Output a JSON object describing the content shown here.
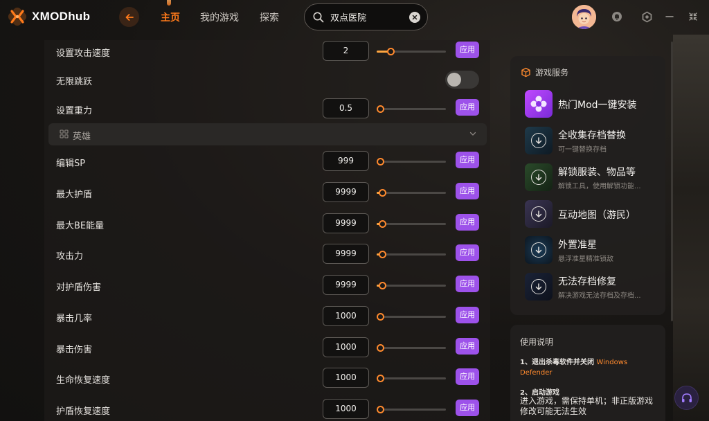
{
  "header": {
    "logo_text": "XMODhub",
    "nav": {
      "home": "主页",
      "my_games": "我的游戏",
      "explore": "探索"
    },
    "search_value": "双点医院",
    "icons": [
      "back-arrow-icon",
      "search-icon",
      "clear-icon",
      "bell-icon",
      "settings-hex-icon",
      "minimize-icon",
      "collapse-icon"
    ]
  },
  "settings": {
    "apply_label": "应用",
    "rows_top": [
      {
        "label": "设置攻击速度",
        "value": "2",
        "level": 0.2
      },
      {
        "label": "无限跳跃",
        "toggle": false
      },
      {
        "label": "设置重力",
        "value": "0.5",
        "level": 0
      }
    ],
    "section": {
      "title": "英雄",
      "collapsed": false
    },
    "rows": [
      {
        "label": "编辑SP",
        "value": "999",
        "level": 0
      },
      {
        "label": "最大护盾",
        "value": "9999",
        "level": 0.08
      },
      {
        "label": "最大BE能量",
        "value": "9999",
        "level": 0.08
      },
      {
        "label": "攻击力",
        "value": "9999",
        "level": 0.08
      },
      {
        "label": "对护盾伤害",
        "value": "9999",
        "level": 0.08
      },
      {
        "label": "暴击几率",
        "value": "1000",
        "level": 0
      },
      {
        "label": "暴击伤害",
        "value": "1000",
        "level": 0
      },
      {
        "label": "生命恢复速度",
        "value": "1000",
        "level": 0
      },
      {
        "label": "护盾恢复速度",
        "value": "1000",
        "level": 0
      }
    ]
  },
  "services": {
    "title": "游戏服务",
    "items": [
      {
        "title": "热门Mod一键安装",
        "sub": ""
      },
      {
        "title": "全收集存档替换",
        "sub": "可一键替换存档"
      },
      {
        "title": "解锁服装、物品等",
        "sub": "解锁工具，使用解锁功能..."
      },
      {
        "title": "互动地图（游民）",
        "sub": ""
      },
      {
        "title": "外置准星",
        "sub": "悬浮准星精准锁敌"
      },
      {
        "title": "无法存档修复",
        "sub": "解决游戏无法存档及存档..."
      }
    ]
  },
  "guide": {
    "title": "使用说明",
    "step1": "1、退出杀毒软件并关闭",
    "step1_highlight": "Windows Defender",
    "step2": "2、启动游戏",
    "step2_desc": "进入游戏，需保持单机；非正版游戏修改可能无法生效"
  },
  "colors": {
    "accent_orange": "#ff7a1a",
    "apply_purple": "#9d52ea"
  }
}
